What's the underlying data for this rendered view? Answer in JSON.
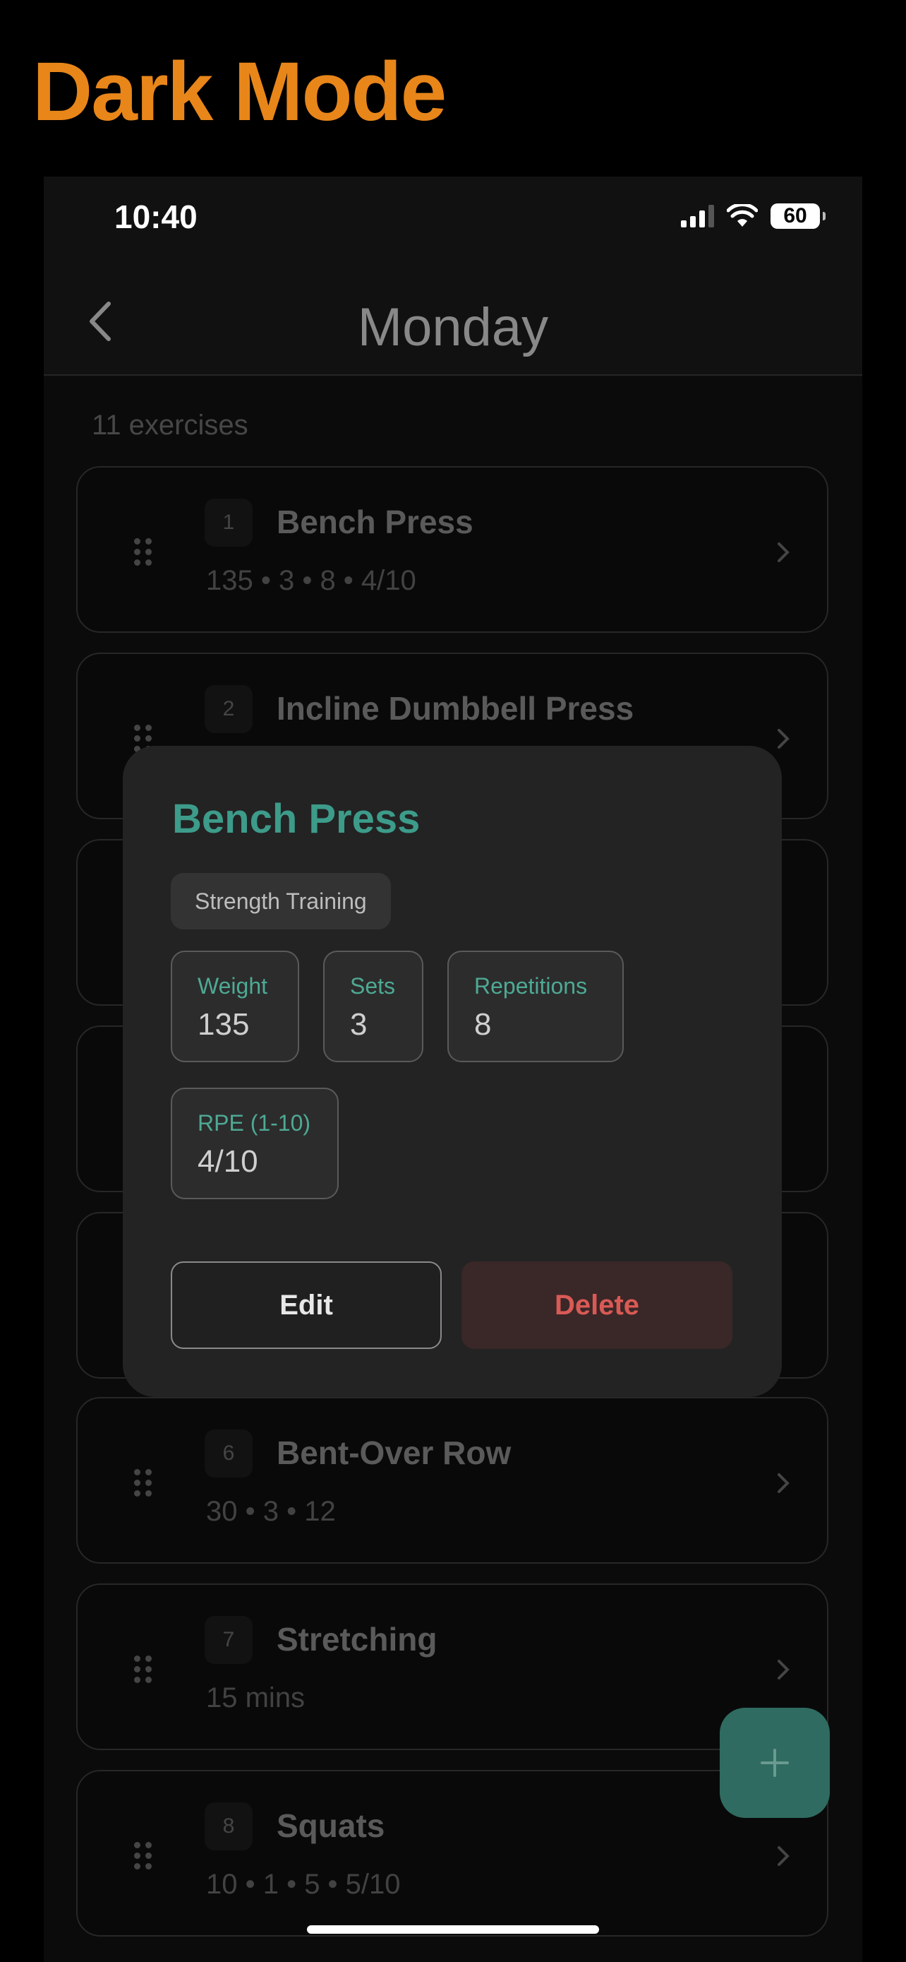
{
  "banner": {
    "label": "Dark Mode"
  },
  "status_bar": {
    "time": "10:40",
    "battery": "60"
  },
  "nav": {
    "title": "Monday"
  },
  "list": {
    "count_label": "11 exercises",
    "items": [
      {
        "index": "1",
        "title": "Bench Press",
        "meta": "135 • 3 • 8 • 4/10"
      },
      {
        "index": "2",
        "title": "Incline Dumbbell Press",
        "meta": ""
      },
      {
        "index": "6",
        "title": "Bent-Over Row",
        "meta": "30 • 3 • 12"
      },
      {
        "index": "7",
        "title": "Stretching",
        "meta": "15 mins"
      },
      {
        "index": "8",
        "title": "Squats",
        "meta": "10 • 1 • 5 • 5/10"
      }
    ]
  },
  "modal": {
    "title": "Bench Press",
    "category": "Strength Training",
    "stats": [
      {
        "label": "Weight",
        "value": "135"
      },
      {
        "label": "Sets",
        "value": "3"
      },
      {
        "label": "Repetitions",
        "value": "8"
      },
      {
        "label": "RPE (1-10)",
        "value": "4/10"
      }
    ],
    "edit_label": "Edit",
    "delete_label": "Delete"
  },
  "colors": {
    "accent": "#3d9b8a",
    "banner": "#e8861a",
    "danger": "#d95a55",
    "fab": "#2f6b60"
  },
  "icons": {
    "back": "chevron-left-icon",
    "grip": "drag-handle-icon",
    "chevron": "chevron-right-icon",
    "fab": "plus-icon"
  }
}
